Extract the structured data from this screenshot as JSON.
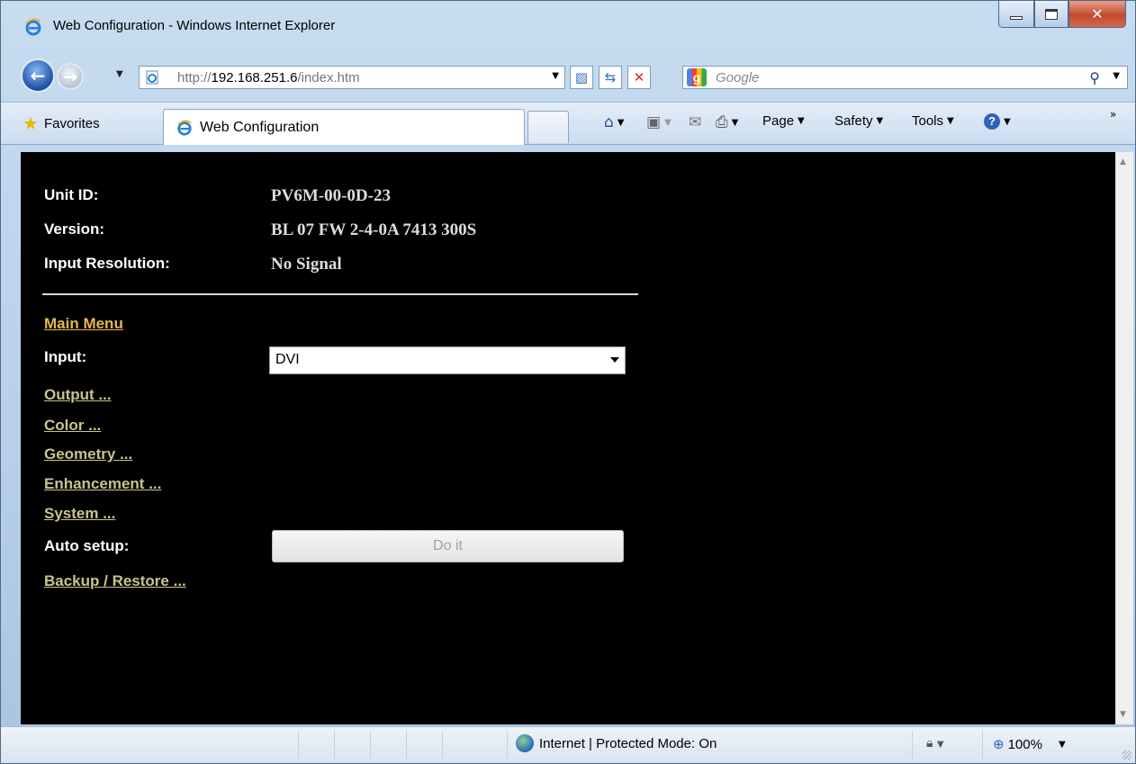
{
  "window": {
    "title": "Web Configuration - Windows Internet Explorer"
  },
  "navbar": {
    "address_prefix": "http://",
    "address_host": "192.168.251.6",
    "address_path": "/index.htm",
    "search_placeholder": "Google"
  },
  "command_bar": {
    "favorites_label": "Favorites",
    "tab_title": "Web Configuration",
    "page_label": "Page",
    "safety_label": "Safety",
    "tools_label": "Tools"
  },
  "info": {
    "unit_id_label": "Unit ID:",
    "unit_id_value": "PV6M-00-0D-23",
    "version_label": "Version:",
    "version_value": "BL 07 FW 2-4-0A 7413 300S",
    "input_resolution_label": "Input Resolution:",
    "input_resolution_value": "No Signal"
  },
  "menu": {
    "main_menu": "Main Menu",
    "input_label": "Input:",
    "input_selected": "DVI",
    "output_link": "Output ...",
    "color_link": "Color ...",
    "geometry_link": "Geometry ...",
    "enhancement_link": "Enhancement ...",
    "system_link": "System ...",
    "auto_setup_label": "Auto setup:",
    "do_it_button": "Do it",
    "backup_restore_link": "Backup / Restore ..."
  },
  "statusbar": {
    "zone_text": "Internet | Protected Mode: On",
    "zoom": "100%"
  },
  "colors": {
    "content_background": "#000000",
    "link_color": "#c8c48c",
    "main_menu_color": "#e5b84a"
  }
}
